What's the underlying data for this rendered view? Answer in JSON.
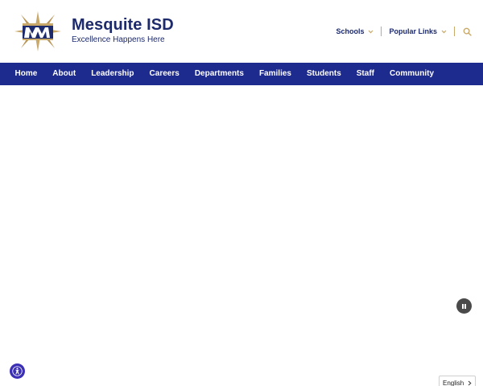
{
  "header": {
    "site_title": "Mesquite ISD",
    "tagline": "Excellence Happens Here",
    "logo_icon": "mesquite-star-m-logo",
    "utility_nav": [
      {
        "label": "Schools",
        "icon": "chevron-down-icon"
      },
      {
        "label": "Popular Links",
        "icon": "chevron-down-icon"
      }
    ],
    "search_icon": "search-icon"
  },
  "nav": {
    "items": [
      {
        "label": "Home"
      },
      {
        "label": "About"
      },
      {
        "label": "Leadership"
      },
      {
        "label": "Careers"
      },
      {
        "label": "Departments"
      },
      {
        "label": "Families"
      },
      {
        "label": "Students"
      },
      {
        "label": "Staff"
      },
      {
        "label": "Community"
      }
    ]
  },
  "hero": {
    "pause_icon": "pause-icon"
  },
  "accessibility": {
    "icon": "accessibility-icon"
  },
  "language": {
    "selected": "English",
    "icon": "chevron-right-icon"
  },
  "colors": {
    "navy": "#1d2a6b",
    "nav_bar": "#1d2a8e",
    "gold": "#c9a96a",
    "accessibility_purple": "#3b2fb6",
    "pause_gray": "#4a4a4a"
  }
}
